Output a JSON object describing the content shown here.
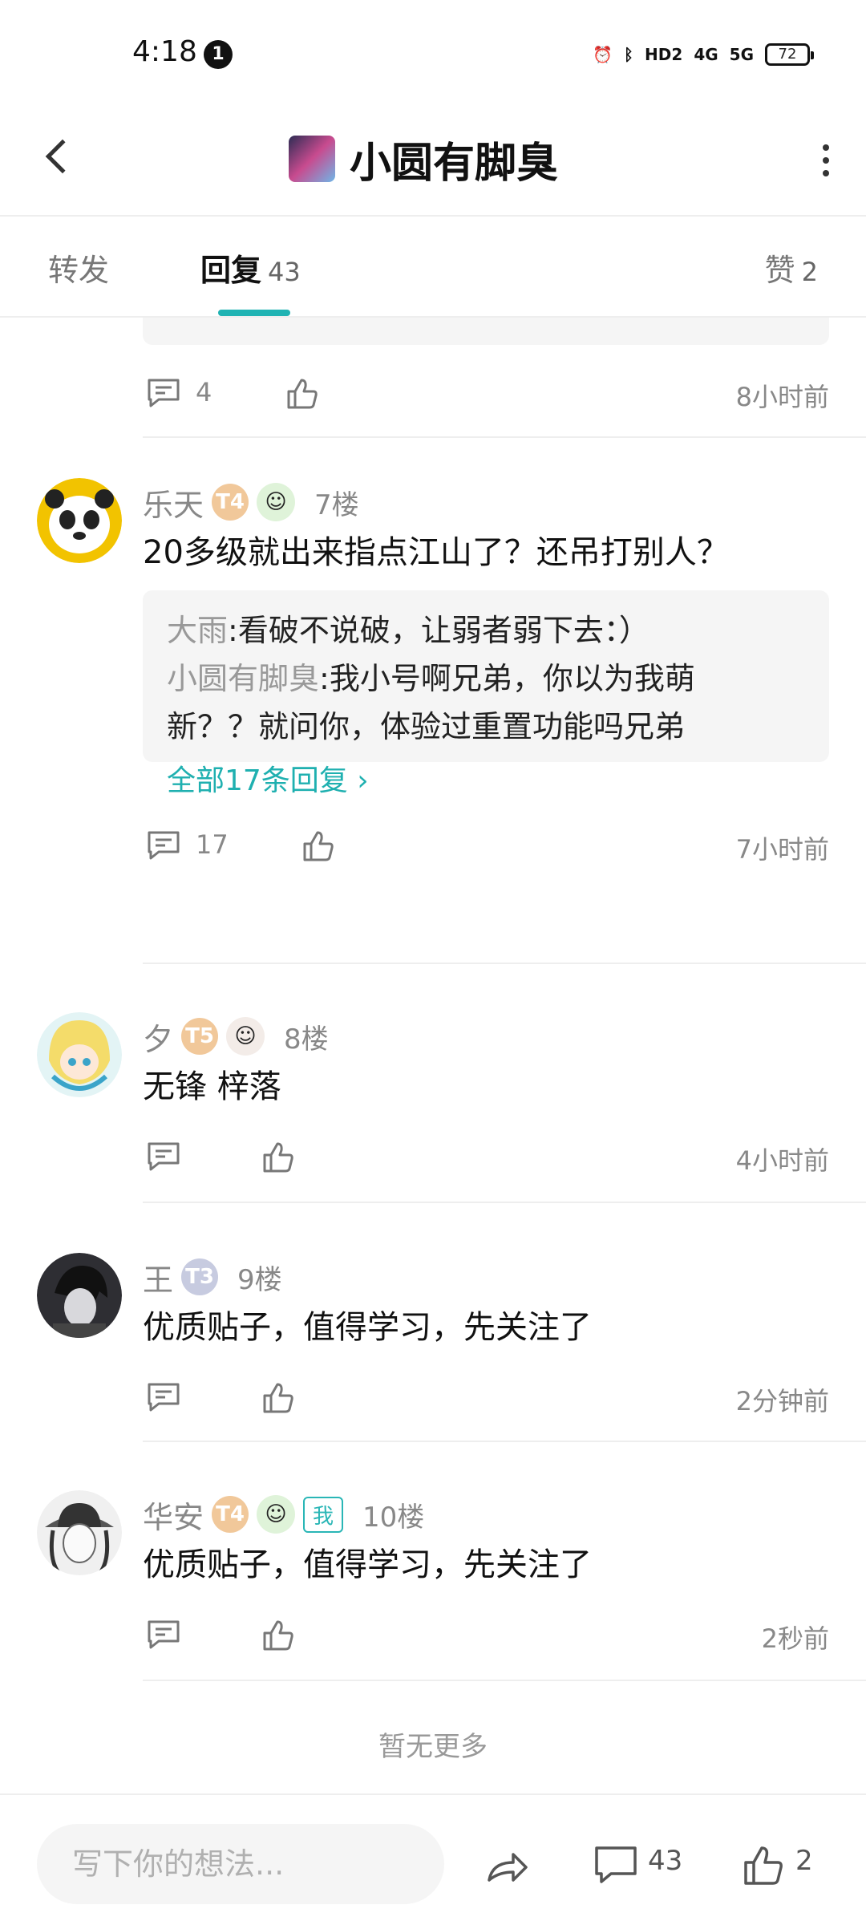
{
  "status_bar": {
    "time": "4:18",
    "notification_count": "1",
    "signal_hd": "HD2",
    "signal_4g": "4G",
    "signal_5g": "5G",
    "battery": "72"
  },
  "header": {
    "title": "小圆有脚臭"
  },
  "tabs": {
    "forward": "转发",
    "reply": "回复",
    "reply_count": "43",
    "like": "赞",
    "like_count": "2"
  },
  "prev_post_actions": {
    "comment_count": "4",
    "time": "8小时前"
  },
  "posts": [
    {
      "username": "乐天",
      "level": "T4",
      "floor": "7楼",
      "text": "20多级就出来指点江山了？还吊打别人？",
      "replies": [
        {
          "name": "大雨",
          "text": ":看破不说破，让弱者弱下去：）"
        },
        {
          "name": "小圆有脚臭",
          "text": ":我小号啊兄弟，你以为我萌"
        },
        {
          "name": "",
          "text": "新？？就问你，体验过重置功能吗兄弟"
        }
      ],
      "more_replies": "全部17条回复 ›",
      "comment_count": "17",
      "time": "7小时前"
    },
    {
      "username": "夕",
      "level": "T5",
      "floor": "8楼",
      "text": "无锋  梓落",
      "comment_count": "",
      "time": "4小时前"
    },
    {
      "username": "王",
      "level": "T3",
      "floor": "9楼",
      "text": "优质贴子，值得学习，先关注了",
      "comment_count": "",
      "time": "2分钟前"
    },
    {
      "username": "华安",
      "level": "T4",
      "me_badge": "我",
      "floor": "10楼",
      "text": "优质贴子，值得学习，先关注了",
      "comment_count": "",
      "time": "2秒前"
    }
  ],
  "no_more": "暂无更多",
  "bottom_bar": {
    "input_placeholder": "写下你的想法...",
    "comment_count": "43",
    "like_count": "2"
  },
  "colors": {
    "accent": "#1fb3b3",
    "muted_text": "#888888",
    "quote_bg": "#f5f5f5"
  }
}
